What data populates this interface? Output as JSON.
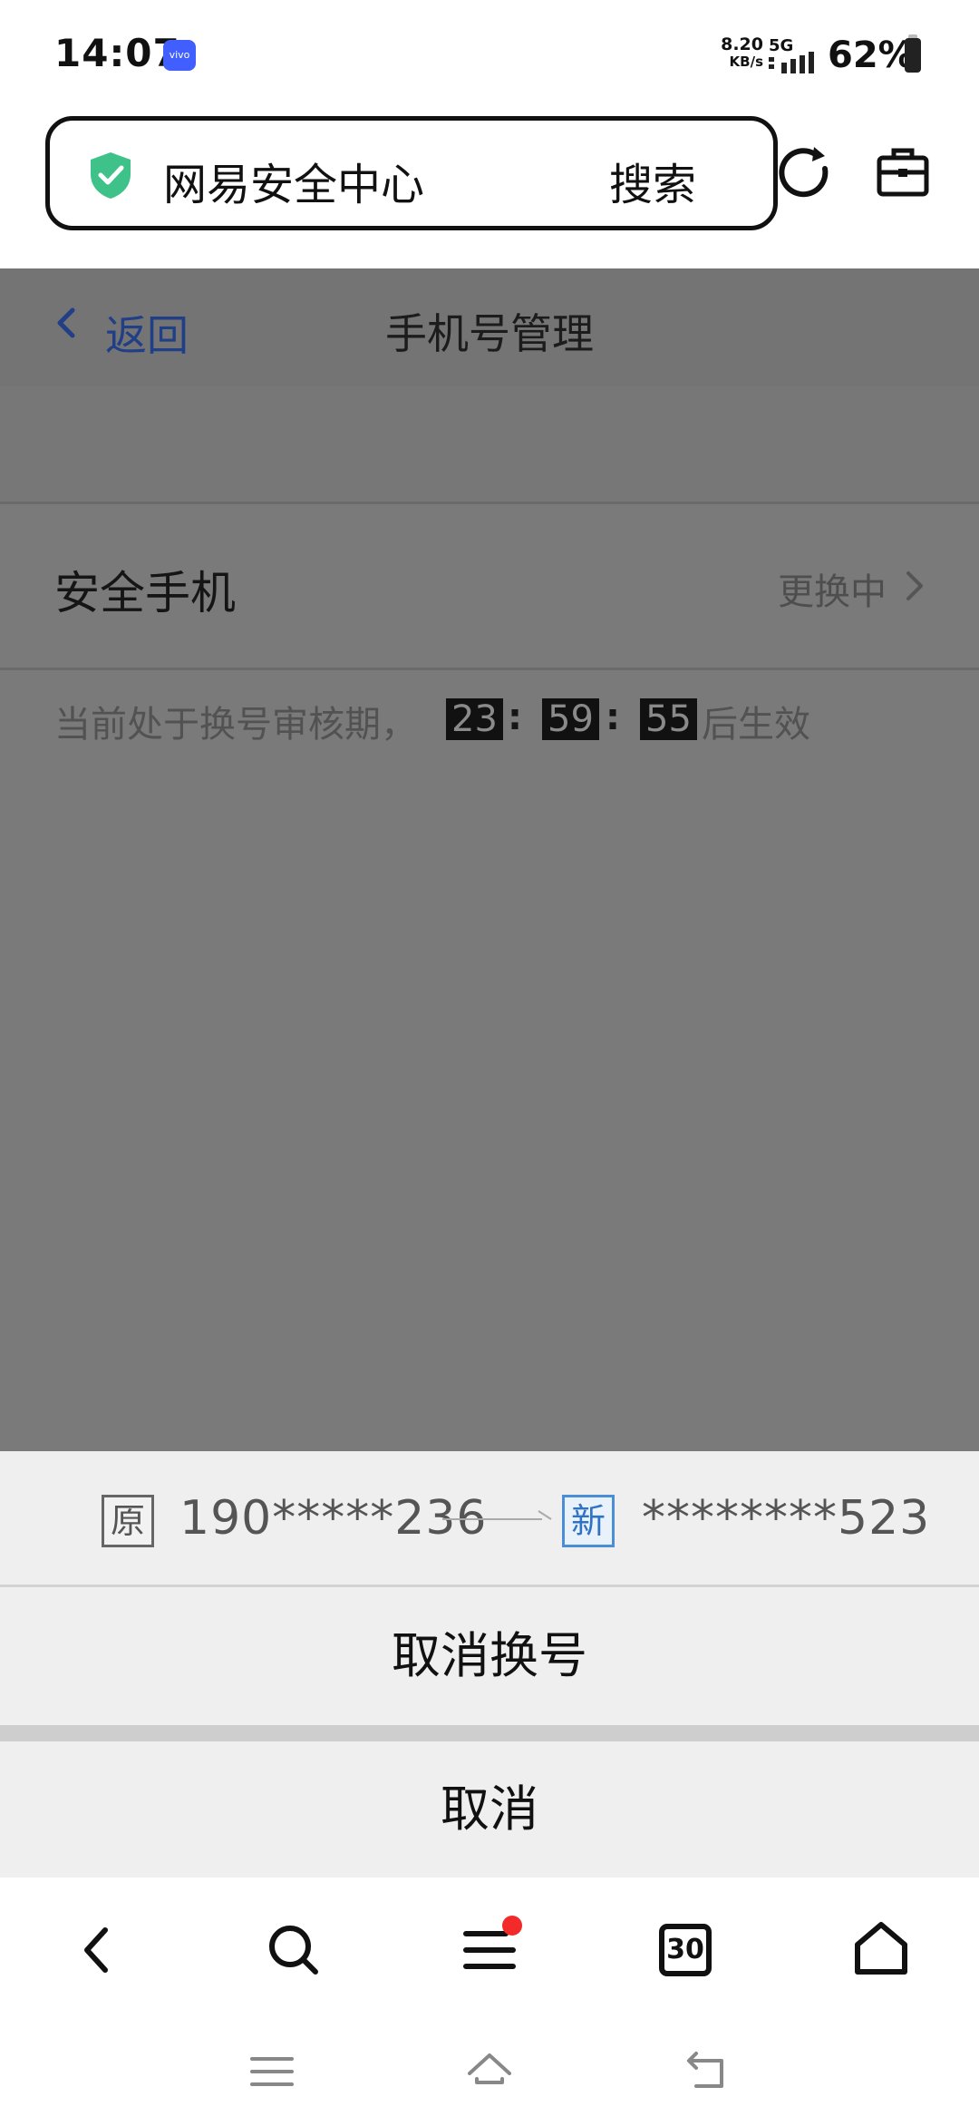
{
  "status_bar": {
    "time": "14:07",
    "carrier_badge": "vivo",
    "net_speed_value": "8.20",
    "net_speed_unit": "KB/s",
    "network_type": "5G",
    "battery_percent": "62%"
  },
  "browser": {
    "url_text": "网易安全中心",
    "search_label": "搜索",
    "icons": [
      "shield-check-icon",
      "reload-icon",
      "toolbox-icon"
    ]
  },
  "page": {
    "back_label": "返回",
    "title": "手机号管理",
    "row_label": "安全手机",
    "row_status": "更换中",
    "notice_prefix": "当前处于换号审核期，",
    "countdown": {
      "hours": "23",
      "minutes": "59",
      "seconds": "55",
      "separator": ":"
    },
    "notice_suffix": "后生效"
  },
  "sheet": {
    "orig_tag": "原",
    "orig_number": "190*****236",
    "new_tag": "新",
    "new_number": "********523",
    "cancel_swap_label": "取消换号",
    "cancel_label": "取消"
  },
  "bottom_nav": {
    "tab_count": "30",
    "icons": [
      "back-icon",
      "search-icon",
      "menu-icon",
      "tabs-icon",
      "home-icon"
    ]
  },
  "colors": {
    "accent_blue": "#2f73c6",
    "shield_green": "#3ec28a",
    "notification_red": "#f32a2a",
    "overlay_gray": "#7a7a7a"
  }
}
